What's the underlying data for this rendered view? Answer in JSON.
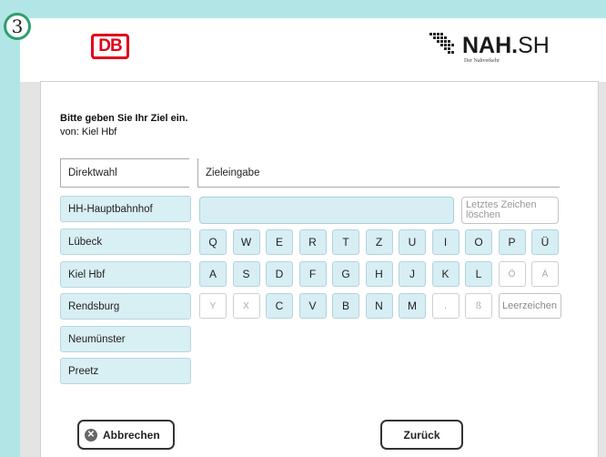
{
  "step_badge": "3",
  "header": {
    "db_logo": "DB",
    "nah_brand_bold": "NAH.",
    "nah_brand_light": "SH",
    "nah_tagline": "Der Nahverkehr"
  },
  "prompt": {
    "title": "Bitte geben Sie Ihr Ziel ein.",
    "from": "von: Kiel Hbf"
  },
  "tabs": {
    "direct": "Direktwahl",
    "entry": "Zieleingabe"
  },
  "direct_choices": [
    "HH-Hauptbahnhof",
    "Lübeck",
    "Kiel Hbf",
    "Rendsburg",
    "Neumünster",
    "Preetz"
  ],
  "destination": {
    "value": "",
    "delete_label": "Letztes Zeichen löschen"
  },
  "keyboard": {
    "row1": [
      "Q",
      "W",
      "E",
      "R",
      "T",
      "Z",
      "U",
      "I",
      "O",
      "P",
      "Ü"
    ],
    "row2": [
      "A",
      "S",
      "D",
      "F",
      "G",
      "H",
      "J",
      "K",
      "L",
      "Ö",
      "Ä"
    ],
    "row3": [
      "Y",
      "X",
      "C",
      "V",
      "B",
      "N",
      "M",
      ".",
      "ß"
    ],
    "space_label": "Leerzeichen",
    "disabled": [
      "Ö",
      "Ä",
      "Y",
      "X",
      ".",
      "ß"
    ]
  },
  "buttons": {
    "cancel": "Abbrechen",
    "back": "Zurück"
  },
  "colors": {
    "background": "#b2e6e6",
    "key": "#d6eef4",
    "db_red": "#e2001a"
  }
}
